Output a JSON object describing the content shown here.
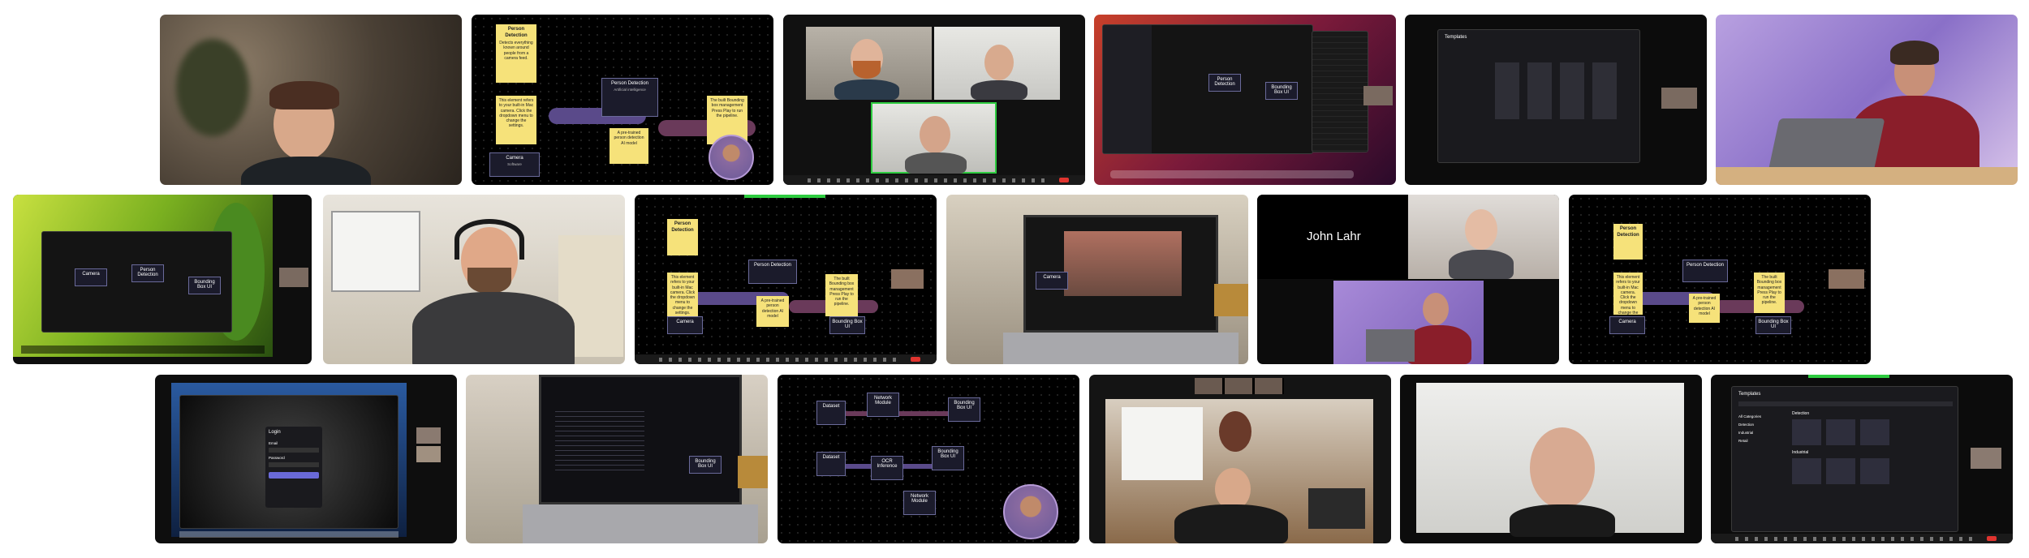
{
  "colors": {
    "sticky": "#f6e27a",
    "node_border": "#6a6a9a",
    "purple_path": "#5a4a8a",
    "tile_bg": "#000000",
    "zoom_end": "#e0342f",
    "zoom_green": "#2ecc40"
  },
  "pipeline": {
    "person_detection_title": "Person Detection",
    "person_detection_sub": "Artificial intelligence",
    "person_detection_note": "Detects everything known around people from a camera feed.",
    "camera_title": "Camera",
    "camera_sub": "Software",
    "camera_note": "This element refers to your built-in Mac camera. Click the dropdown menu to change the settings.",
    "model_note": "A pre-trained person detection AI model",
    "bbox_title": "Bounding Box UI",
    "bbox_sub": "Software",
    "bbox_note": "The built Bounding box management Press Play to run the pipeline."
  },
  "generic": {
    "node_a": "Camera",
    "node_b": "Person Detection",
    "node_c": "Bounding Box UI",
    "node_d": "Network Module",
    "node_e": "Dataset",
    "node_f": "OCR Inference"
  },
  "participants": {
    "john_lahr": "John Lahr"
  },
  "login": {
    "title": "Login",
    "email_label": "Email",
    "password_label": "Password",
    "button": "Log in"
  },
  "templates": {
    "title": "Templates",
    "section_a": "Detection",
    "section_b": "Industrial",
    "side_a": "All Categories",
    "side_b": "Detection",
    "side_c": "Industrial",
    "side_d": "Retail"
  },
  "icons": [
    "mic-icon",
    "camera-icon",
    "share-screen-icon",
    "end-call-icon",
    "play-icon"
  ]
}
